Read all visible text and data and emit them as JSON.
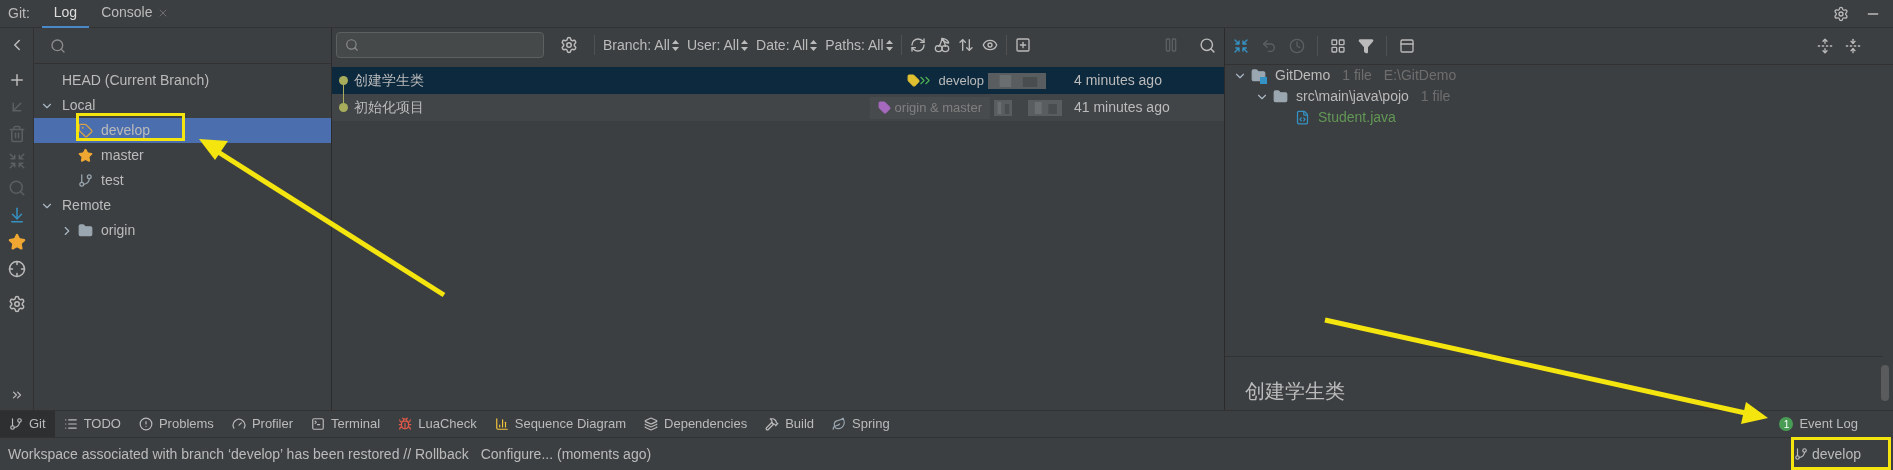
{
  "tool_window": {
    "title": "Git:",
    "tabs": [
      {
        "label": "Log",
        "selected": true,
        "closable": false
      },
      {
        "label": "Console",
        "selected": false,
        "closable": true
      }
    ]
  },
  "branches": {
    "items": [
      {
        "label": "HEAD (Current Branch)",
        "kind": "head",
        "selected": false
      },
      {
        "label": "Local",
        "kind": "group",
        "expanded": true,
        "selected": false,
        "children": [
          {
            "label": "develop",
            "kind": "tag",
            "selected": true
          },
          {
            "label": "master",
            "kind": "star",
            "selected": false
          },
          {
            "label": "test",
            "kind": "branch",
            "selected": false
          }
        ]
      },
      {
        "label": "Remote",
        "kind": "group",
        "expanded": true,
        "selected": false,
        "children": [
          {
            "label": "origin",
            "kind": "folder",
            "expanded": false,
            "selected": false
          }
        ]
      }
    ]
  },
  "log": {
    "filters": [
      "Branch: All",
      "User: All",
      "Date: All",
      "Paths: All"
    ],
    "commits": [
      {
        "message": "创建学生类",
        "ref": "develop",
        "remote": false,
        "time": "4 minutes ago",
        "selected": true
      },
      {
        "message": "初始化项目",
        "ref": "origin & master",
        "remote": true,
        "time": "41 minutes ago",
        "selected": false
      }
    ]
  },
  "changes": {
    "tree": [
      {
        "label": "GitDemo",
        "count": "1 file",
        "path": "E:\\GitDemo",
        "kind": "module",
        "expanded": true,
        "children": [
          {
            "label": "src\\main\\java\\pojo",
            "count": "1 file",
            "kind": "folder",
            "expanded": true,
            "children": [
              {
                "label": "Student.java",
                "kind": "file"
              }
            ]
          }
        ]
      }
    ],
    "details": "创建学生类"
  },
  "bottom_tools": [
    {
      "label": "Git",
      "kind": "git",
      "selected": true
    },
    {
      "label": "TODO",
      "kind": "list",
      "selected": false
    },
    {
      "label": "Problems",
      "kind": "alert",
      "selected": false
    },
    {
      "label": "Profiler",
      "kind": "profiler",
      "selected": false
    },
    {
      "label": "Terminal",
      "kind": "terminal",
      "selected": false
    },
    {
      "label": "LuaCheck",
      "kind": "lua",
      "selected": false
    },
    {
      "label": "Sequence Diagram",
      "kind": "sequence",
      "selected": false
    },
    {
      "label": "Dependencies",
      "kind": "layers",
      "selected": false
    },
    {
      "label": "Build",
      "kind": "hammer",
      "selected": false
    },
    {
      "label": "Spring",
      "kind": "leaf",
      "selected": false
    }
  ],
  "event_log": {
    "label": "Event Log",
    "count": "1"
  },
  "status_bar": {
    "message": "Workspace associated with branch ‘develop’ has been restored // Rollback",
    "link": "Configure... (moments ago)",
    "branch": "develop"
  }
}
